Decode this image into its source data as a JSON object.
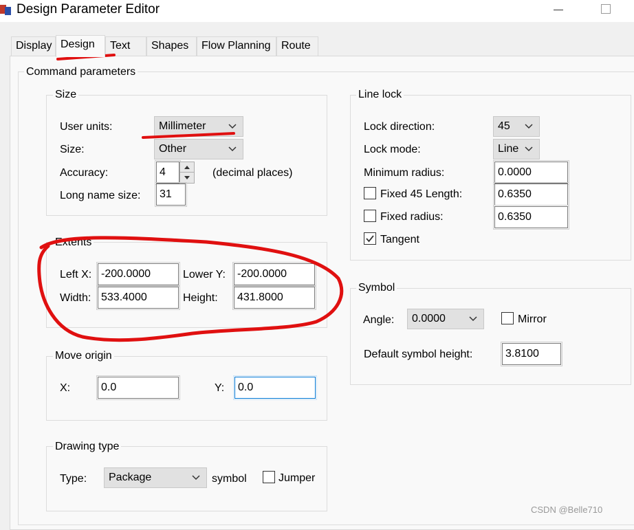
{
  "window": {
    "title": "Design Parameter Editor"
  },
  "tabs": [
    {
      "label": "Display",
      "active": false
    },
    {
      "label": "Design",
      "active": true
    },
    {
      "label": "Text",
      "active": false
    },
    {
      "label": "Shapes",
      "active": false
    },
    {
      "label": "Flow Planning",
      "active": false
    },
    {
      "label": "Route",
      "active": false
    }
  ],
  "command_parameters": {
    "label": "Command parameters"
  },
  "size": {
    "label": "Size",
    "user_units_label": "User units:",
    "user_units_value": "Millimeter",
    "size_label": "Size:",
    "size_value": "Other",
    "accuracy_label": "Accuracy:",
    "accuracy_value": "4",
    "accuracy_suffix": "(decimal places)",
    "long_name_label": "Long name size:",
    "long_name_value": "31"
  },
  "extents": {
    "label": "Extents",
    "left_x_label": "Left X:",
    "left_x_value": "-200.0000",
    "lower_y_label": "Lower Y:",
    "lower_y_value": "-200.0000",
    "width_label": "Width:",
    "width_value": "533.4000",
    "height_label": "Height:",
    "height_value": "431.8000"
  },
  "move_origin": {
    "label": "Move origin",
    "x_label": "X:",
    "x_value": "0.0",
    "y_label": "Y:",
    "y_value": "0.0"
  },
  "drawing_type": {
    "label": "Drawing type",
    "type_label": "Type:",
    "type_value": "Package",
    "symbol_label": "symbol",
    "jumper_label": "Jumper",
    "jumper_checked": false
  },
  "line_lock": {
    "label": "Line lock",
    "lock_direction_label": "Lock direction:",
    "lock_direction_value": "45",
    "lock_mode_label": "Lock mode:",
    "lock_mode_value": "Line",
    "min_radius_label": "Minimum radius:",
    "min_radius_value": "0.0000",
    "fixed45_label": "Fixed 45 Length:",
    "fixed45_value": "0.6350",
    "fixed45_checked": false,
    "fixed_radius_label": "Fixed radius:",
    "fixed_radius_value": "0.6350",
    "fixed_radius_checked": false,
    "tangent_label": "Tangent",
    "tangent_checked": true
  },
  "symbol": {
    "label": "Symbol",
    "angle_label": "Angle:",
    "angle_value": "0.0000",
    "mirror_label": "Mirror",
    "mirror_checked": false,
    "default_height_label": "Default symbol height:",
    "default_height_value": "3.8100"
  },
  "watermark": "CSDN @Belle710",
  "colors": {
    "annotation_red": "#e01010",
    "focus_blue": "#0078d7"
  }
}
